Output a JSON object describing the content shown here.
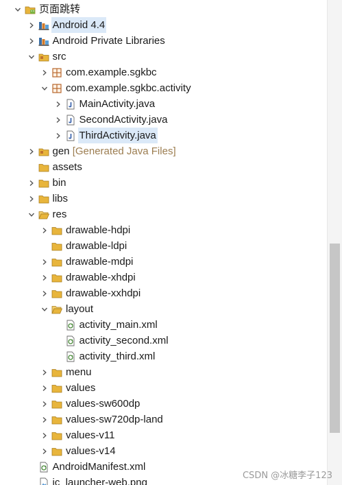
{
  "tree": [
    {
      "label": "页面跳转",
      "icon": "android-project-icon",
      "chev": "down",
      "depth": 0
    },
    {
      "label": "Android 4.4",
      "icon": "library-icon",
      "chev": "right",
      "depth": 1,
      "selected": true
    },
    {
      "label": "Android Private Libraries",
      "icon": "library-icon",
      "chev": "right",
      "depth": 1
    },
    {
      "label": "src",
      "icon": "source-folder-icon",
      "chev": "down",
      "depth": 1
    },
    {
      "label": "com.example.sgkbc",
      "icon": "package-icon",
      "chev": "right",
      "depth": 2
    },
    {
      "label": "com.example.sgkbc.activity",
      "icon": "package-icon",
      "chev": "down",
      "depth": 2
    },
    {
      "label": "MainActivity.java",
      "icon": "java-file-icon",
      "chev": "right",
      "depth": 3
    },
    {
      "label": "SecondActivity.java",
      "icon": "java-file-icon",
      "chev": "right",
      "depth": 3
    },
    {
      "label": "ThirdActivity.java",
      "icon": "java-file-icon",
      "chev": "right",
      "depth": 3,
      "selected": true
    },
    {
      "label": "gen",
      "decoration": "[Generated Java Files]",
      "icon": "source-folder-icon",
      "chev": "right",
      "depth": 1
    },
    {
      "label": "assets",
      "icon": "folder-icon",
      "chev": "none",
      "depth": 1
    },
    {
      "label": "bin",
      "icon": "folder-icon",
      "chev": "right",
      "depth": 1
    },
    {
      "label": "libs",
      "icon": "folder-icon",
      "chev": "right",
      "depth": 1
    },
    {
      "label": "res",
      "icon": "folder-open-icon",
      "chev": "down",
      "depth": 1
    },
    {
      "label": "drawable-hdpi",
      "icon": "folder-icon",
      "chev": "right",
      "depth": 2
    },
    {
      "label": "drawable-ldpi",
      "icon": "folder-icon",
      "chev": "none",
      "depth": 2
    },
    {
      "label": "drawable-mdpi",
      "icon": "folder-icon",
      "chev": "right",
      "depth": 2
    },
    {
      "label": "drawable-xhdpi",
      "icon": "folder-icon",
      "chev": "right",
      "depth": 2
    },
    {
      "label": "drawable-xxhdpi",
      "icon": "folder-icon",
      "chev": "right",
      "depth": 2
    },
    {
      "label": "layout",
      "icon": "folder-open-icon",
      "chev": "down",
      "depth": 2
    },
    {
      "label": "activity_main.xml",
      "icon": "xml-file-icon",
      "chev": "none",
      "depth": 3
    },
    {
      "label": "activity_second.xml",
      "icon": "xml-file-icon",
      "chev": "none",
      "depth": 3
    },
    {
      "label": "activity_third.xml",
      "icon": "xml-file-icon",
      "chev": "none",
      "depth": 3
    },
    {
      "label": "menu",
      "icon": "folder-icon",
      "chev": "right",
      "depth": 2
    },
    {
      "label": "values",
      "icon": "folder-icon",
      "chev": "right",
      "depth": 2
    },
    {
      "label": "values-sw600dp",
      "icon": "folder-icon",
      "chev": "right",
      "depth": 2
    },
    {
      "label": "values-sw720dp-land",
      "icon": "folder-icon",
      "chev": "right",
      "depth": 2
    },
    {
      "label": "values-v11",
      "icon": "folder-icon",
      "chev": "right",
      "depth": 2
    },
    {
      "label": "values-v14",
      "icon": "folder-icon",
      "chev": "right",
      "depth": 2
    },
    {
      "label": "AndroidManifest.xml",
      "icon": "xml-file-icon",
      "chev": "none",
      "depth": 1
    },
    {
      "label": "ic_launcher-web.png",
      "icon": "image-file-icon",
      "chev": "none",
      "depth": 1
    }
  ],
  "watermark": "CSDN @冰糖李子123",
  "colors": {
    "selection": "#dbe9f8",
    "decoration": "#9c7d50",
    "folder": "#e8b53c",
    "package": "#b8672d",
    "java": "#2f5aa8",
    "xml": "#4a8a3a",
    "library": "#6b6b6b"
  }
}
